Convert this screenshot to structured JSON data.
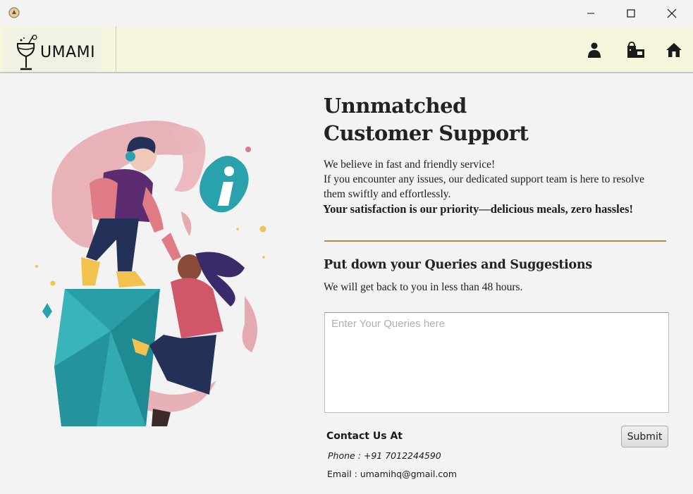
{
  "window": {
    "app_icon": "app-logo-icon",
    "controls": {
      "minimize": "minimize-icon",
      "maximize": "maximize-icon",
      "close": "close-icon"
    }
  },
  "header": {
    "logo_text": "UMAMI",
    "logo_icon": "cocktail-glass-icon",
    "icons": [
      "profile-icon",
      "shop-icon",
      "home-icon"
    ]
  },
  "illustration": {
    "icon": "customer-support-illustration"
  },
  "content": {
    "heading_line1": "Unnmatched",
    "heading_line2": "Customer Support",
    "desc_line1": "We believe in fast and friendly service!",
    "desc_line2": "If you encounter any issues, our dedicated support team is here to resolve",
    "desc_line3": "them swiftly and effortlessly.",
    "desc_bold": "Your satisfaction is our priority—delicious meals, zero hassles!",
    "sub_heading": "Put down your Queries and Suggestions",
    "sub_note": "We will get back to you in less than 48 hours."
  },
  "form": {
    "query_placeholder": "Enter Your Queries here",
    "query_value": "",
    "submit_label": "Submit"
  },
  "contact": {
    "title": "Contact Us At",
    "phone": "Phone : +91 7012244590",
    "email": "Email : umamihq@gmail.com"
  },
  "colors": {
    "header_bg": "#f6f6dc",
    "divider_accent": "#b08a50",
    "window_bg": "#f3f3f3"
  }
}
